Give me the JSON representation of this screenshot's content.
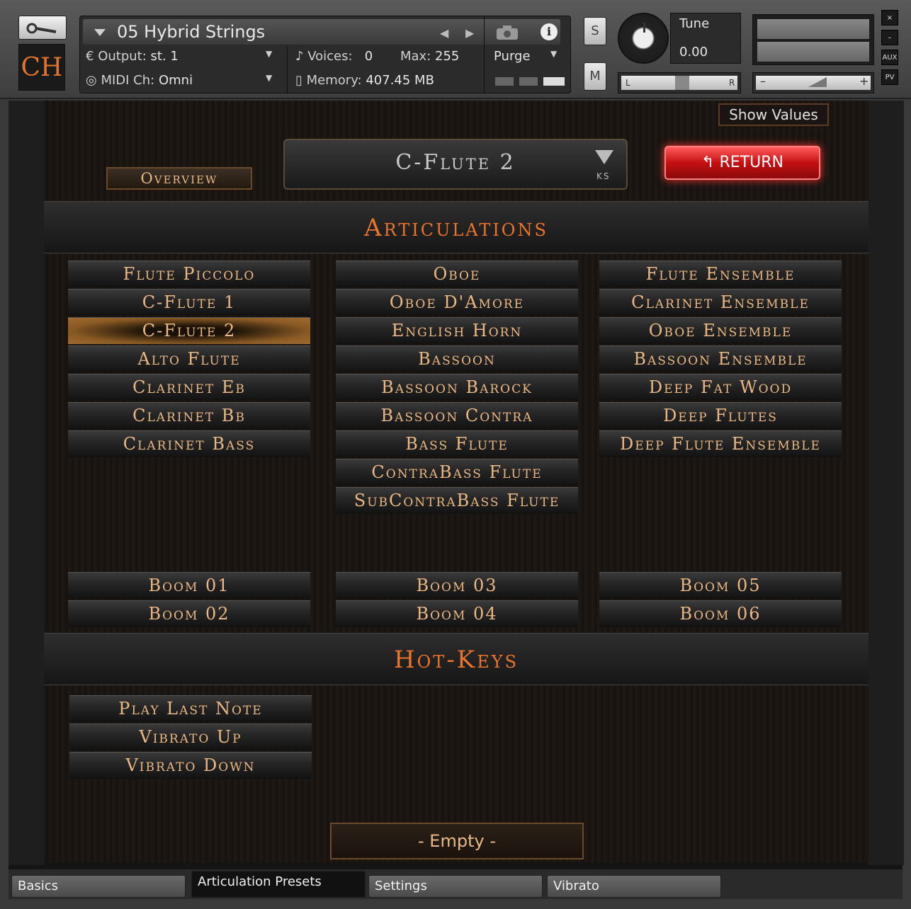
{
  "header": {
    "instrument_name": "05 Hybrid Strings",
    "logo_text": "CH",
    "output_label": "Output:",
    "output_value": "st. 1",
    "voices_label": "Voices:",
    "voices_value": "0",
    "max_label": "Max:",
    "max_value": "255",
    "purge_label": "Purge",
    "midi_label": "MIDI Ch:",
    "midi_value": "Omni",
    "memory_label": "Memory:",
    "memory_value": "407.45 MB",
    "solo_label": "S",
    "mute_label": "M",
    "tune_label": "Tune",
    "tune_value": "0.00",
    "pan_left": "L",
    "pan_right": "R",
    "vol_minus": "–",
    "vol_plus": "+",
    "side_buttons": [
      "×",
      "–",
      "AUX",
      "PV"
    ]
  },
  "toolbar": {
    "show_values_label": "Show Values",
    "overview_label": "Overview",
    "preset_name": "C-Flute 2",
    "preset_ks": "KS",
    "return_label": "RETURN"
  },
  "articulations": {
    "title": "Articulations",
    "col1": [
      "Flute Piccolo",
      "C-Flute 1",
      "C-Flute 2",
      "Alto Flute",
      "Clarinet Eb",
      "Clarinet Bb",
      "Clarinet Bass"
    ],
    "col2": [
      "Oboe",
      "Oboe D'Amore",
      "English Horn",
      "Bassoon",
      "Bassoon Barock",
      "Bassoon Contra",
      "Bass Flute",
      "ContraBass Flute",
      "SubContraBass Flute"
    ],
    "col3": [
      "Flute Ensemble",
      "Clarinet Ensemble",
      "Oboe Ensemble",
      "Bassoon Ensemble",
      "Deep Fat Wood",
      "Deep Flutes",
      "Deep Flute Ensemble"
    ],
    "booms": [
      "Boom 01",
      "Boom 02",
      "Boom 03",
      "Boom 04",
      "Boom 05",
      "Boom 06"
    ],
    "selected": "C-Flute 2"
  },
  "hotkeys": {
    "title": "Hot-Keys",
    "items": [
      "Play Last Note",
      "Vibrato Up",
      "Vibrato Down"
    ]
  },
  "footer": {
    "empty_label": "- Empty -"
  },
  "tabs": [
    {
      "label": "Basics"
    },
    {
      "label": "Articulation Presets"
    },
    {
      "label": "Settings"
    },
    {
      "label": "Vibrato"
    }
  ],
  "colors": {
    "accent": "#e9742a",
    "button_text": "#eab884",
    "return_red": "#c40f12"
  }
}
